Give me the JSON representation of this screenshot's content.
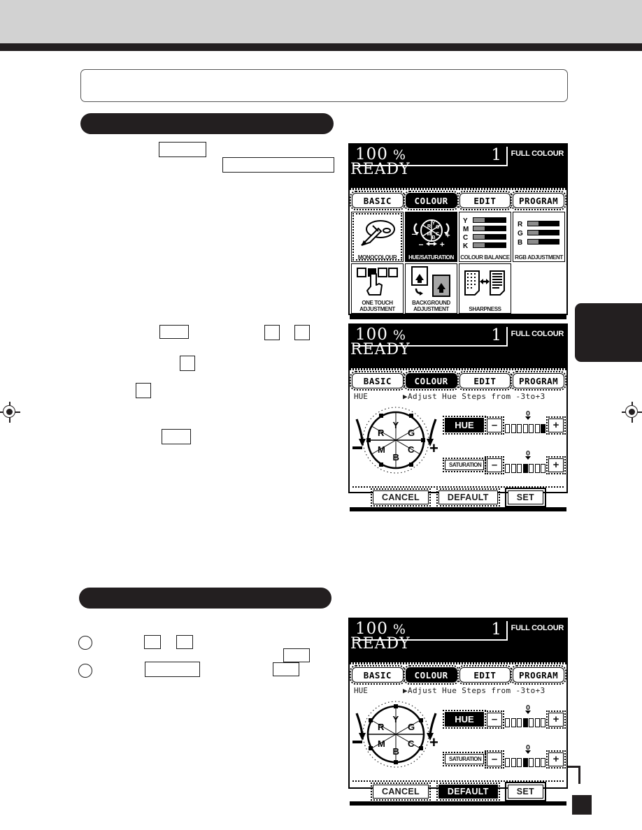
{
  "page": {
    "kind": "scanned-manual-page",
    "registration_marks": 2,
    "index_tab_color": "#231f20",
    "header_band_color": "#d2d2d2",
    "rule_color": "#231f20"
  },
  "panels": [
    {
      "id": "panel-colour-menu",
      "status": {
        "zoom": "100",
        "percent_sign": "%",
        "copies": "1",
        "mode": "FULL COLOUR",
        "message": "READY"
      },
      "tabs": [
        {
          "label": "BASIC",
          "selected": false
        },
        {
          "label": "COLOUR",
          "selected": true
        },
        {
          "label": "EDIT",
          "selected": false
        },
        {
          "label": "PROGRAM",
          "selected": false
        }
      ],
      "functions": [
        {
          "name": "MONOCOLOUR",
          "icon": "palette-brush-icon",
          "selected": false,
          "span": 1
        },
        {
          "name": "HUE/SATURATION",
          "icon": "colour-wheel-icon",
          "selected": true,
          "span": 1
        },
        {
          "name": "COLOUR BALANCE",
          "icon": "ymck-bars-icon",
          "selected": false,
          "span": 1,
          "channels": [
            "Y",
            "M",
            "C",
            "K"
          ]
        },
        {
          "name": "RGB ADJUSTMENT",
          "icon": "rgb-bars-icon",
          "selected": false,
          "span": 1,
          "channels": [
            "R",
            "G",
            "B"
          ]
        },
        {
          "name": "ONE TOUCH ADJUSTMENT",
          "icon": "finger-press-icon",
          "selected": false,
          "span": 1
        },
        {
          "name": "BACKGROUND ADJUSTMENT",
          "icon": "document-background-icon",
          "selected": false,
          "span": 1
        },
        {
          "name": "SHARPNESS",
          "icon": "sharpness-pages-icon",
          "selected": false,
          "span": 1
        }
      ]
    },
    {
      "id": "panel-hue-adjusted",
      "status": {
        "zoom": "100",
        "percent_sign": "%",
        "copies": "1",
        "mode": "FULL COLOUR",
        "message": "READY"
      },
      "tabs": [
        {
          "label": "BASIC",
          "selected": false
        },
        {
          "label": "COLOUR",
          "selected": true
        },
        {
          "label": "EDIT",
          "selected": false
        },
        {
          "label": "PROGRAM",
          "selected": false
        }
      ],
      "title": "HUE",
      "instruction": "▶Adjust Hue Steps from -3to+3",
      "wheel": {
        "segments": [
          "R",
          "Y",
          "G",
          "C",
          "B",
          "M"
        ],
        "minus_label": "–",
        "plus_label": "+"
      },
      "sliders": [
        {
          "label": "HUE",
          "selected": true,
          "minus": "–",
          "plus": "+",
          "zero_label": "O",
          "cells": 7,
          "active_index": 7,
          "value": "+3"
        },
        {
          "label": "SATURATION",
          "selected": false,
          "minus": "–",
          "plus": "+",
          "zero_label": "O",
          "cells": 7,
          "active_index": 4,
          "value": "0"
        }
      ],
      "buttons": [
        {
          "label": "CANCEL",
          "selected": false,
          "ring": false
        },
        {
          "label": "DEFAULT",
          "selected": false,
          "ring": false
        },
        {
          "label": "SET",
          "selected": false,
          "ring": true
        }
      ]
    },
    {
      "id": "panel-hue-default",
      "status": {
        "zoom": "100",
        "percent_sign": "%",
        "copies": "1",
        "mode": "FULL COLOUR",
        "message": "READY"
      },
      "tabs": [
        {
          "label": "BASIC",
          "selected": false
        },
        {
          "label": "COLOUR",
          "selected": true
        },
        {
          "label": "EDIT",
          "selected": false
        },
        {
          "label": "PROGRAM",
          "selected": false
        }
      ],
      "title": "HUE",
      "instruction": "▶Adjust Hue Steps from -3to+3",
      "wheel": {
        "segments": [
          "R",
          "Y",
          "G",
          "C",
          "B",
          "M"
        ],
        "minus_label": "–",
        "plus_label": "+"
      },
      "sliders": [
        {
          "label": "HUE",
          "selected": true,
          "minus": "–",
          "plus": "+",
          "zero_label": "O",
          "cells": 7,
          "active_index": 4,
          "value": "0"
        },
        {
          "label": "SATURATION",
          "selected": false,
          "minus": "–",
          "plus": "+",
          "zero_label": "O",
          "cells": 7,
          "active_index": 4,
          "value": "0"
        }
      ],
      "buttons": [
        {
          "label": "CANCEL",
          "selected": false,
          "ring": false
        },
        {
          "label": "DEFAULT",
          "selected": true,
          "ring": false
        },
        {
          "label": "SET",
          "selected": false,
          "ring": true
        }
      ]
    }
  ]
}
